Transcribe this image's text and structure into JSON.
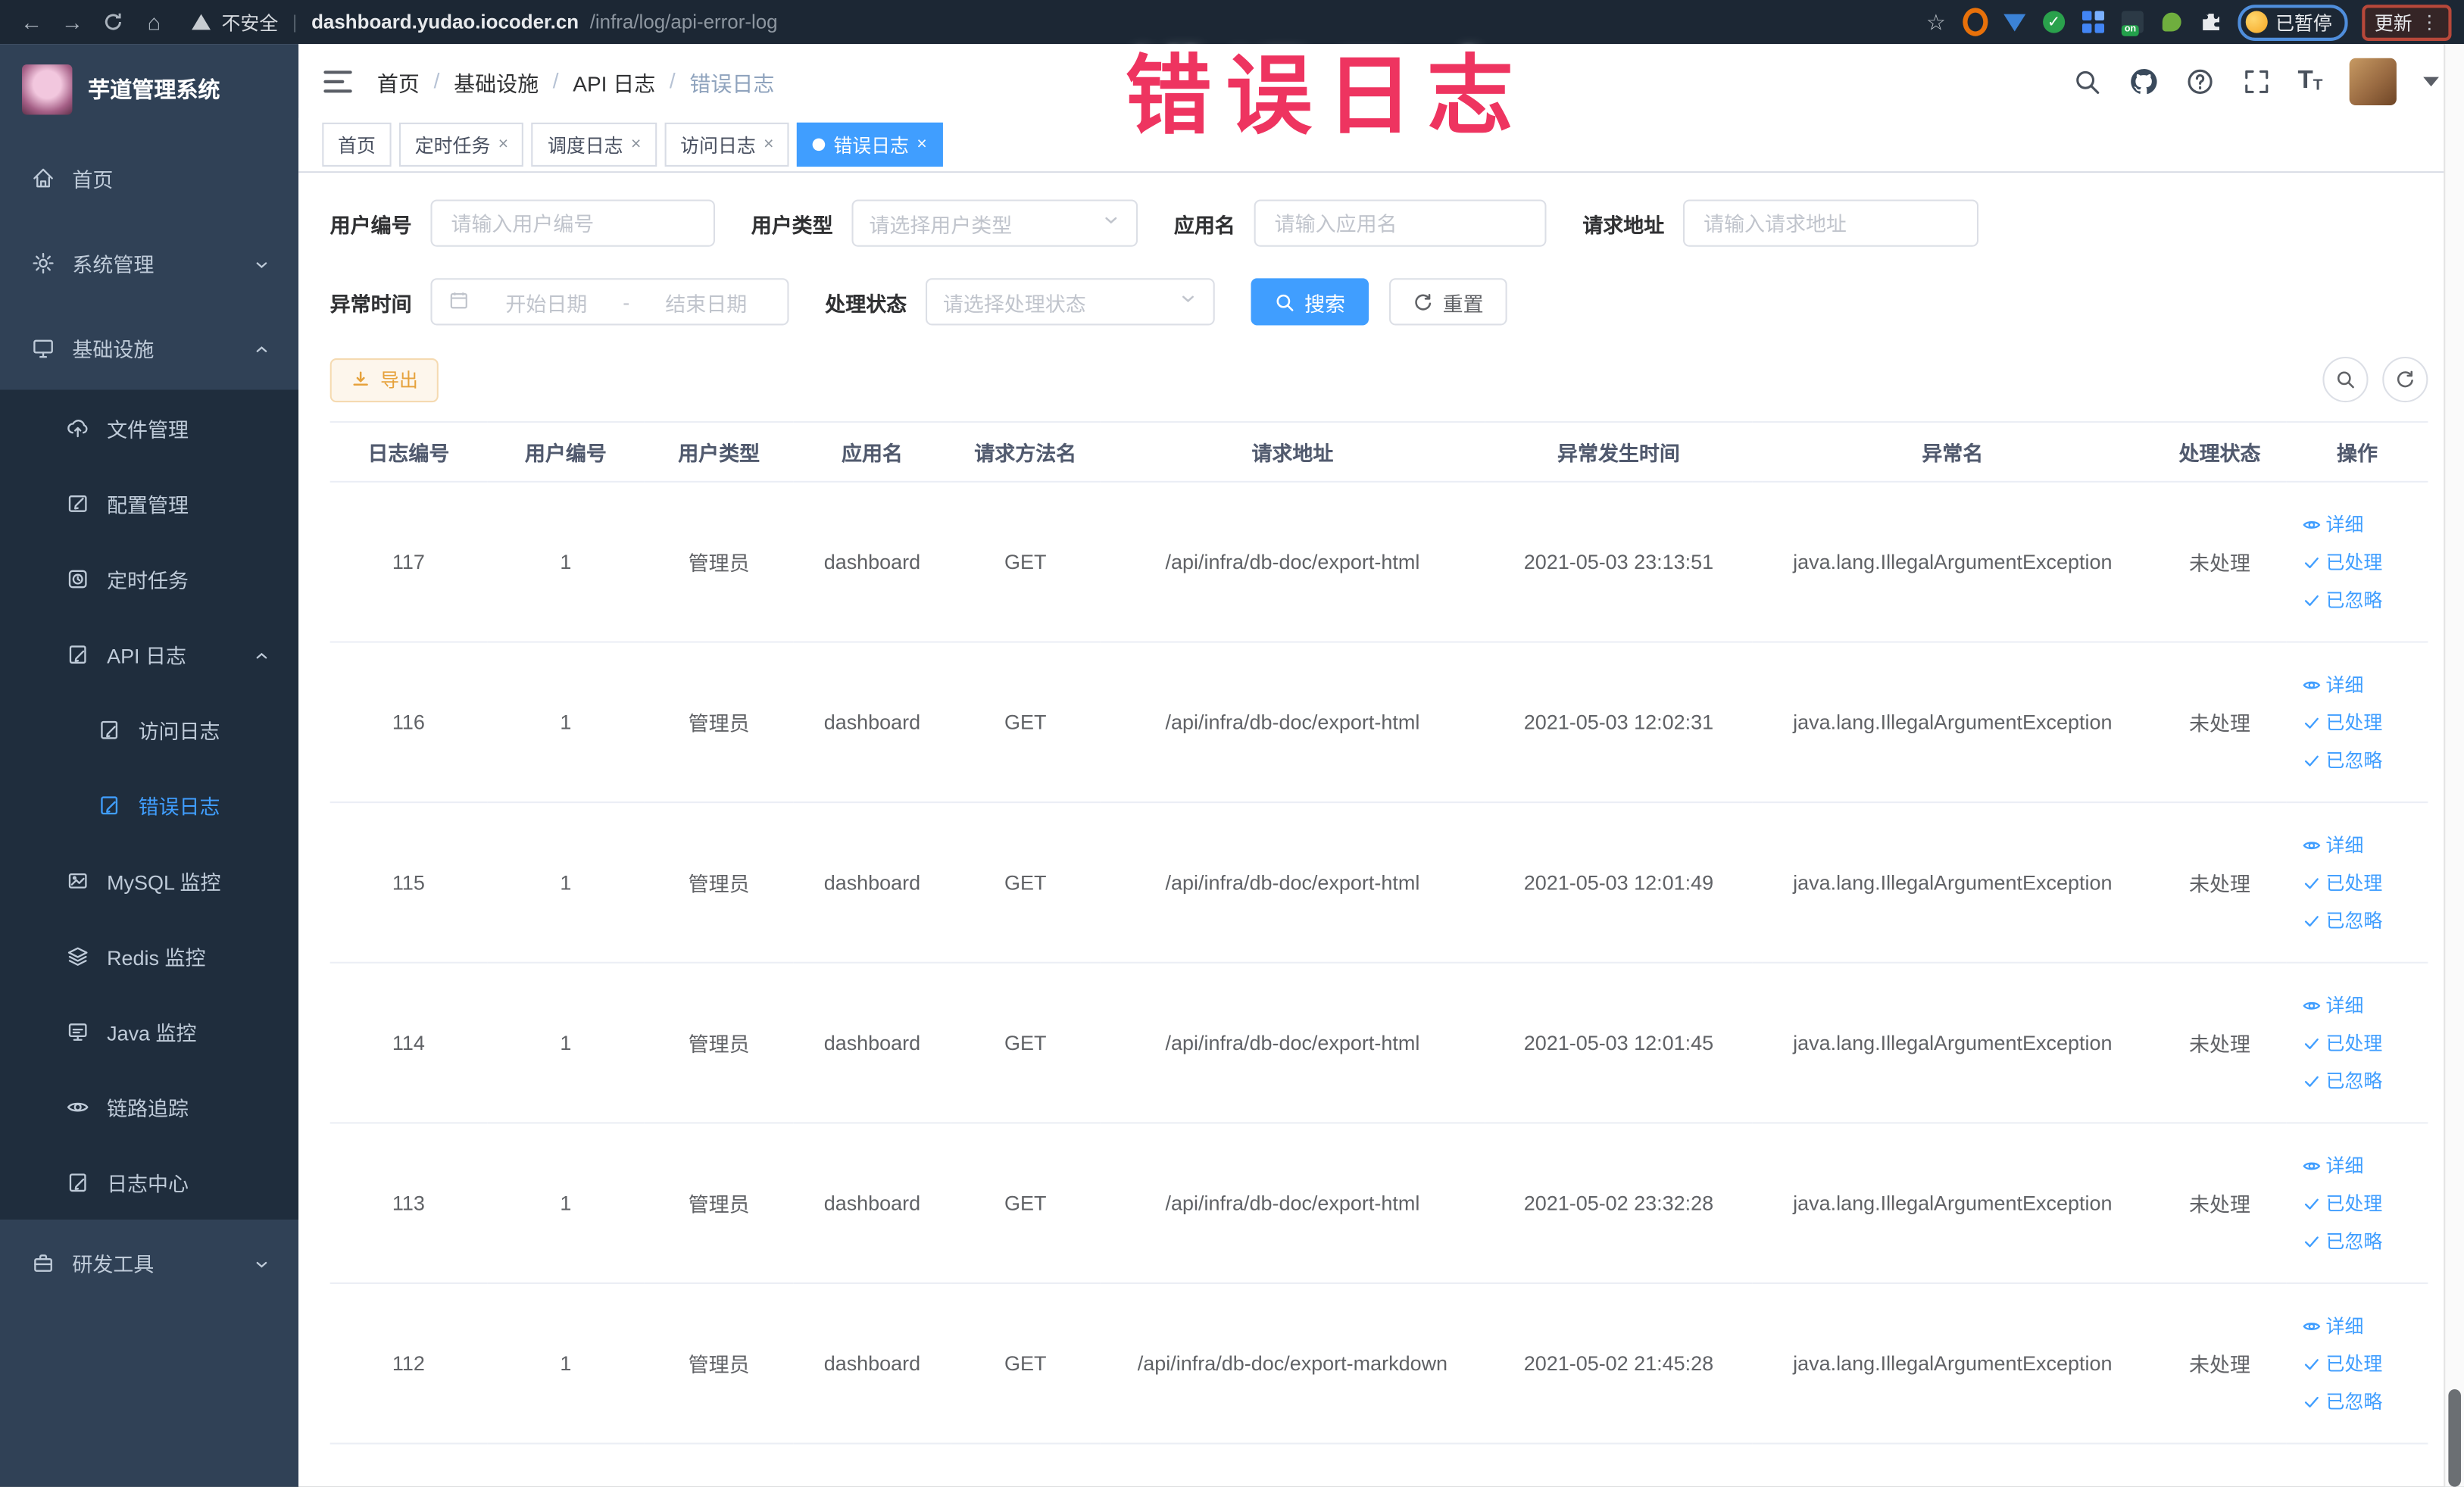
{
  "colors": {
    "accent": "#409eff",
    "sidebar_bg": "#304156",
    "submenu_bg": "#1f2d3d",
    "annotation": "#ee3460",
    "warning_btn_text": "#e6a23c",
    "active_tab_bg": "#409eff"
  },
  "glyphs": {
    "back": "←",
    "forward": "→",
    "home": "⌂",
    "star": "☆",
    "close": "×",
    "more_vertical": "⋮",
    "url_divider": "|",
    "breadcrumb_separator": "/",
    "range_separator": "-",
    "check": "✓",
    "help": "?",
    "font_size_large": "T",
    "font_size_small": "T",
    "ext_on": "on"
  },
  "browser": {
    "security_label": "不安全",
    "url_host": "dashboard.yudao.iocoder.cn",
    "url_path": "/infra/log/api-error-log",
    "paused_label": "已暂停",
    "update_label": "更新"
  },
  "annotation": {
    "text": "错误日志"
  },
  "sidebar": {
    "app_title": "芋道管理系统",
    "items": [
      {
        "label": "首页"
      },
      {
        "label": "系统管理"
      },
      {
        "label": "基础设施"
      },
      {
        "label": "文件管理"
      },
      {
        "label": "配置管理"
      },
      {
        "label": "定时任务"
      },
      {
        "label": "API 日志"
      },
      {
        "label": "访问日志"
      },
      {
        "label": "错误日志"
      },
      {
        "label": "MySQL 监控"
      },
      {
        "label": "Redis 监控"
      },
      {
        "label": "Java 监控"
      },
      {
        "label": "链路追踪"
      },
      {
        "label": "日志中心"
      },
      {
        "label": "研发工具"
      }
    ]
  },
  "header": {
    "breadcrumb": [
      "首页",
      "基础设施",
      "API 日志",
      "错误日志"
    ]
  },
  "tabs": [
    {
      "label": "首页"
    },
    {
      "label": "定时任务"
    },
    {
      "label": "调度日志"
    },
    {
      "label": "访问日志"
    },
    {
      "label": "错误日志"
    }
  ],
  "filters": {
    "user_id": {
      "label": "用户编号",
      "placeholder": "请输入用户编号"
    },
    "user_type": {
      "label": "用户类型",
      "placeholder": "请选择用户类型"
    },
    "app_name": {
      "label": "应用名",
      "placeholder": "请输入应用名"
    },
    "request_url": {
      "label": "请求地址",
      "placeholder": "请输入请求地址"
    },
    "exception_time": {
      "label": "异常时间",
      "start_placeholder": "开始日期",
      "end_placeholder": "结束日期"
    },
    "process_status": {
      "label": "处理状态",
      "placeholder": "请选择处理状态"
    },
    "search_label": "搜索",
    "reset_label": "重置"
  },
  "toolbar": {
    "export_label": "导出"
  },
  "table": {
    "columns": [
      "日志编号",
      "用户编号",
      "用户类型",
      "应用名",
      "请求方法名",
      "请求地址",
      "异常发生时间",
      "异常名",
      "处理状态",
      "操作"
    ],
    "actions": {
      "detail": "详细",
      "processed": "已处理",
      "ignored": "已忽略"
    },
    "rows": [
      {
        "id": "117",
        "user_id": "1",
        "user_type": "管理员",
        "app": "dashboard",
        "method": "GET",
        "url": "/api/infra/db-doc/export-html",
        "time": "2021-05-03 23:13:51",
        "exception": "java.lang.IllegalArgumentException",
        "status": "未处理"
      },
      {
        "id": "116",
        "user_id": "1",
        "user_type": "管理员",
        "app": "dashboard",
        "method": "GET",
        "url": "/api/infra/db-doc/export-html",
        "time": "2021-05-03 12:02:31",
        "exception": "java.lang.IllegalArgumentException",
        "status": "未处理"
      },
      {
        "id": "115",
        "user_id": "1",
        "user_type": "管理员",
        "app": "dashboard",
        "method": "GET",
        "url": "/api/infra/db-doc/export-html",
        "time": "2021-05-03 12:01:49",
        "exception": "java.lang.IllegalArgumentException",
        "status": "未处理"
      },
      {
        "id": "114",
        "user_id": "1",
        "user_type": "管理员",
        "app": "dashboard",
        "method": "GET",
        "url": "/api/infra/db-doc/export-html",
        "time": "2021-05-03 12:01:45",
        "exception": "java.lang.IllegalArgumentException",
        "status": "未处理"
      },
      {
        "id": "113",
        "user_id": "1",
        "user_type": "管理员",
        "app": "dashboard",
        "method": "GET",
        "url": "/api/infra/db-doc/export-html",
        "time": "2021-05-02 23:32:28",
        "exception": "java.lang.IllegalArgumentException",
        "status": "未处理"
      },
      {
        "id": "112",
        "user_id": "1",
        "user_type": "管理员",
        "app": "dashboard",
        "method": "GET",
        "url": "/api/infra/db-doc/export-markdown",
        "time": "2021-05-02 21:45:28",
        "exception": "java.lang.IllegalArgumentException",
        "status": "未处理"
      }
    ]
  }
}
